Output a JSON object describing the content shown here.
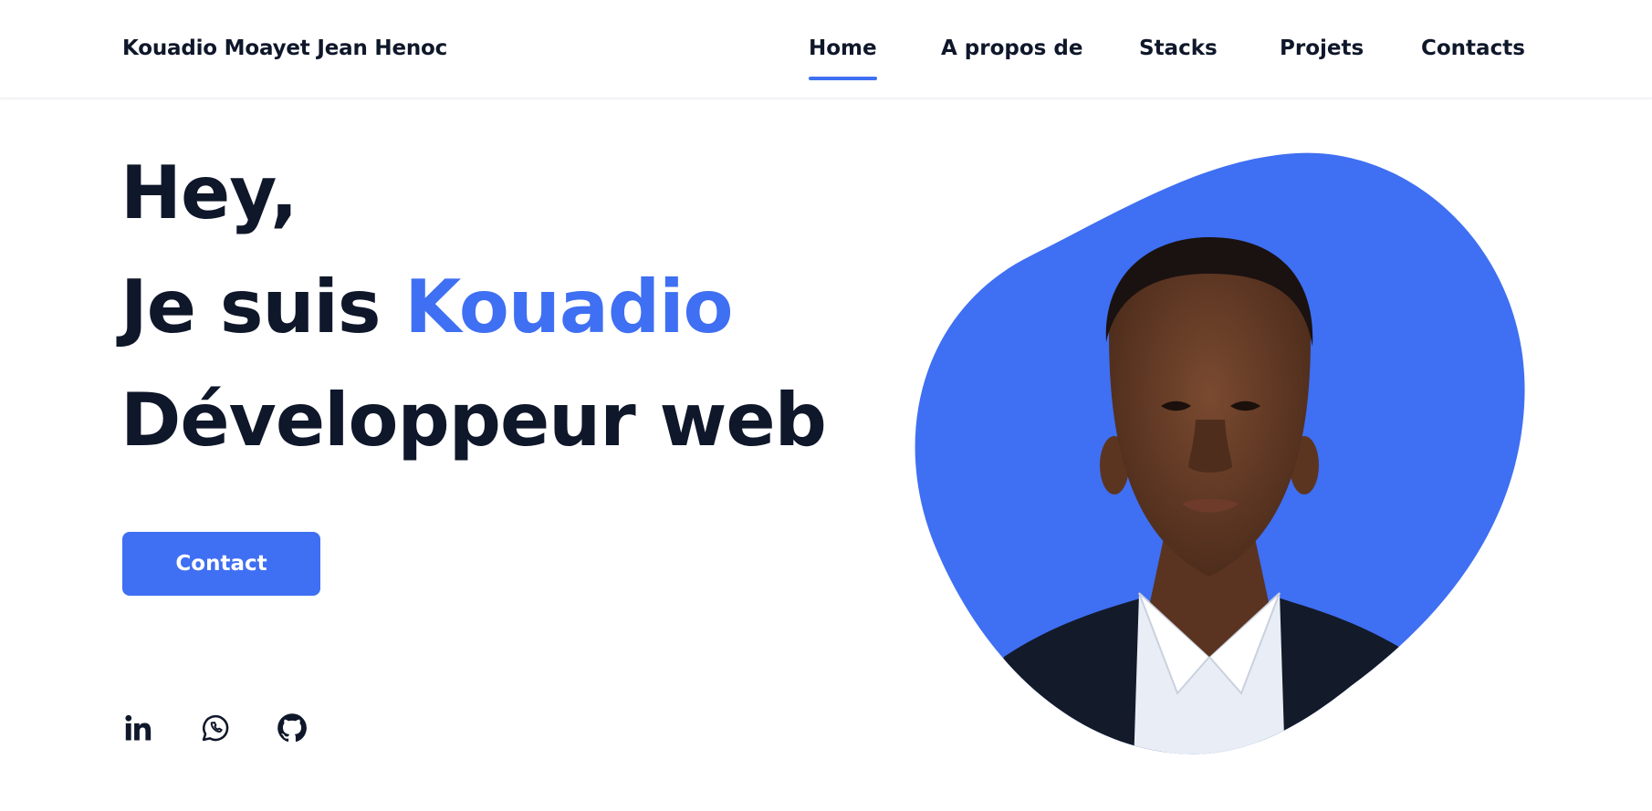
{
  "header": {
    "brand": "Kouadio Moayet Jean Henoc",
    "nav": [
      {
        "label": "Home",
        "active": true
      },
      {
        "label": "A propos de",
        "active": false
      },
      {
        "label": "Stacks",
        "active": false
      },
      {
        "label": "Projets",
        "active": false
      },
      {
        "label": "Contacts",
        "active": false
      }
    ]
  },
  "hero": {
    "line1": "Hey,",
    "line2_prefix": "Je suis ",
    "line2_name": "Kouadio",
    "line3": "Développeur web",
    "cta_label": "Contact"
  },
  "social": [
    {
      "icon": "linkedin-icon"
    },
    {
      "icon": "whatsapp-icon"
    },
    {
      "icon": "github-icon"
    }
  ],
  "colors": {
    "accent": "#3f6ff2",
    "text": "#0f172a",
    "background": "#ffffff"
  }
}
